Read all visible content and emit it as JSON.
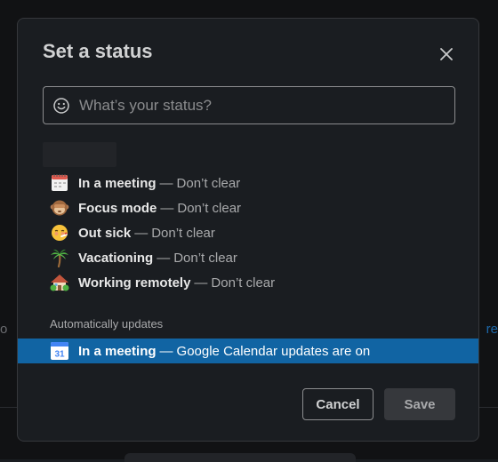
{
  "background": {
    "left_fragment": "o",
    "right_fragment": "re"
  },
  "dialog": {
    "title": "Set a status",
    "close_icon": "close-icon"
  },
  "status_input": {
    "placeholder": "What’s your status?",
    "value": "",
    "icon": "smile-icon"
  },
  "presets": [
    {
      "icon": "calendar-icon",
      "name": "In a meeting",
      "separator": "—",
      "duration": "Don’t clear"
    },
    {
      "icon": "monkey-icon",
      "name": "Focus mode",
      "separator": "—",
      "duration": "Don’t clear"
    },
    {
      "icon": "sick-face-icon",
      "name": "Out sick",
      "separator": "—",
      "duration": "Don’t clear"
    },
    {
      "icon": "palm-tree-icon",
      "name": "Vacationing",
      "separator": "—",
      "duration": "Don’t clear"
    },
    {
      "icon": "house-icon",
      "name": "Working remotely",
      "separator": "—",
      "duration": "Don’t clear"
    }
  ],
  "automatic": {
    "section_label": "Automatically updates",
    "item": {
      "icon": "google-calendar-icon",
      "icon_text": "31",
      "name": "In a meeting",
      "separator": "—",
      "detail": "Google Calendar updates are on"
    }
  },
  "buttons": {
    "cancel_label": "Cancel",
    "save_label": "Save"
  },
  "colors": {
    "highlight": "#1164a3",
    "modal_bg": "#1a1d21"
  }
}
